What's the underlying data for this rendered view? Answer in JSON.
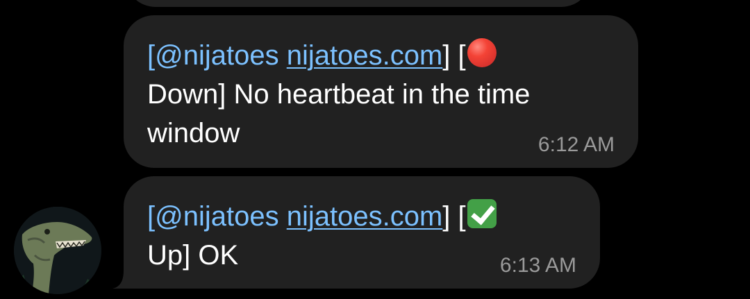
{
  "messages": [
    {
      "mention": "[@nijatoes",
      "link": "nijatoes.com",
      "bracket_close": "]",
      "status_open": "[",
      "status_emoji": "red-circle-emoji",
      "status_word": "Down]",
      "body": "No heartbeat in the time window",
      "time": "6:12 AM"
    },
    {
      "mention": "[@nijatoes",
      "link": "nijatoes.com",
      "bracket_close": "]",
      "status_open": "[",
      "status_emoji": "check-mark-button-emoji",
      "status_word": "Up]",
      "body": "OK",
      "time": "6:13 AM"
    }
  ],
  "avatar": {
    "icon": "dinosaur-avatar",
    "colors": [
      "#6c7a57",
      "#0f1416"
    ]
  },
  "theme": {
    "background": "#000000",
    "bubble": "#212121",
    "link": "#7cc1ff",
    "time": "#9a9a9a"
  }
}
